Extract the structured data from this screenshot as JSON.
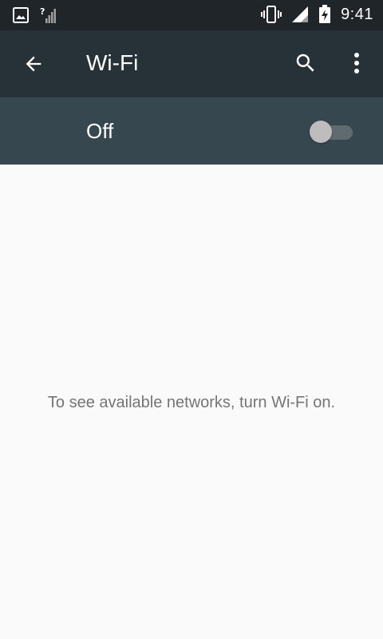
{
  "status_bar": {
    "time": "9:41",
    "icons": [
      "image-notification-icon",
      "signal-unknown-icon",
      "vibrate-icon",
      "signal-strength-icon",
      "battery-charging-icon"
    ]
  },
  "toolbar": {
    "title": "Wi-Fi",
    "back_icon": "arrow-back-icon",
    "search_icon": "search-icon",
    "more_icon": "more-vert-icon",
    "background": "#263238"
  },
  "wifi_switch": {
    "label": "Off",
    "state": "off",
    "background": "#37474f"
  },
  "content": {
    "message": "To see available networks, turn Wi-Fi on."
  }
}
